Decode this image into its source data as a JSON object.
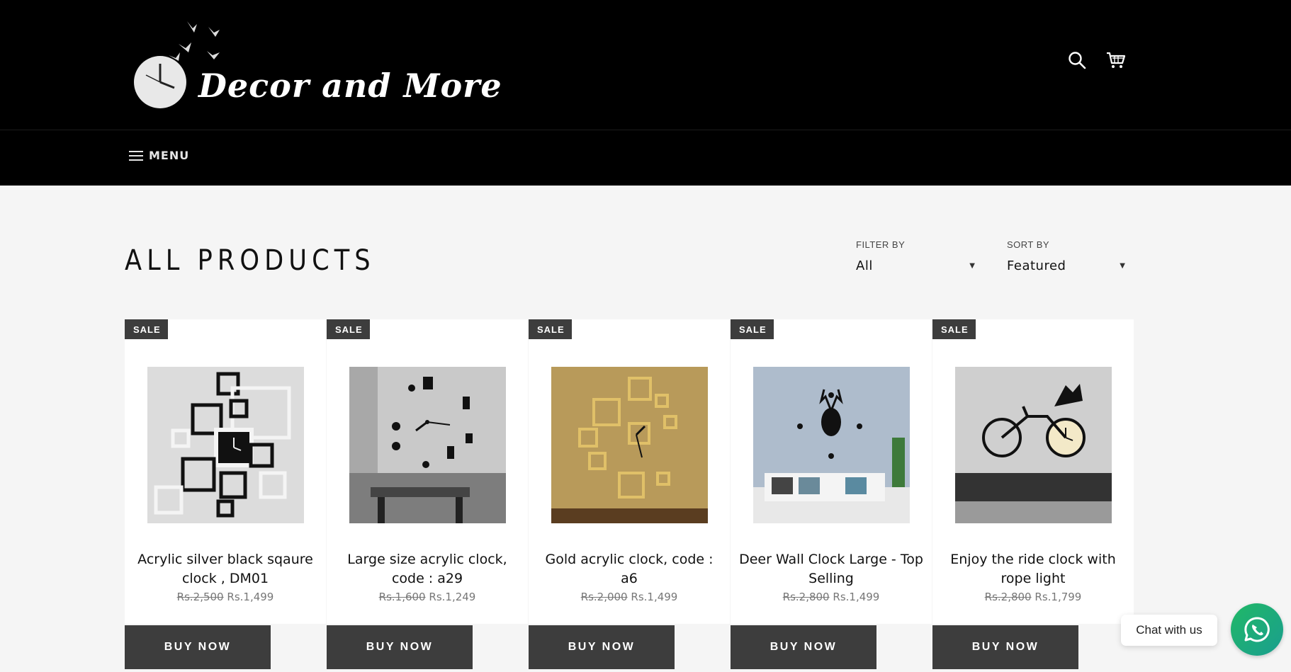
{
  "header": {
    "logo_text": "Decor and More",
    "search_icon": "search-icon",
    "cart_icon": "cart-icon",
    "menu_label": "MENU",
    "menu_icon": "hamburger-icon"
  },
  "collection": {
    "title": "ALL PRODUCTS",
    "filter_label": "FILTER BY",
    "filter_value": "All",
    "sort_label": "SORT BY",
    "sort_value": "Featured"
  },
  "products": [
    {
      "badge": "SALE",
      "title": "Acrylic silver black sqaure clock , DM01",
      "old_price": "Rs.2,500",
      "price": "Rs.1,499",
      "button": "BUY NOW"
    },
    {
      "badge": "SALE",
      "title": "Large size acrylic clock, code : a29",
      "old_price": "Rs.1,600",
      "price": "Rs.1,249",
      "button": "BUY NOW"
    },
    {
      "badge": "SALE",
      "title": "Gold acrylic clock, code : a6",
      "old_price": "Rs.2,000",
      "price": "Rs.1,499",
      "button": "BUY NOW"
    },
    {
      "badge": "SALE",
      "title": "Deer Wall Clock Large - Top Selling",
      "old_price": "Rs.2,800",
      "price": "Rs.1,499",
      "button": "BUY NOW"
    },
    {
      "badge": "SALE",
      "title": "Enjoy the ride clock with rope light",
      "old_price": "Rs.2,800",
      "price": "Rs.1,799",
      "button": "BUY NOW"
    }
  ],
  "chat": {
    "label": "Chat with us",
    "icon": "whatsapp-icon"
  },
  "colors": {
    "header_bg": "#000000",
    "page_bg": "#f5f5f5",
    "button_bg": "#3d3d3d",
    "whatsapp_green": "#20b866"
  }
}
